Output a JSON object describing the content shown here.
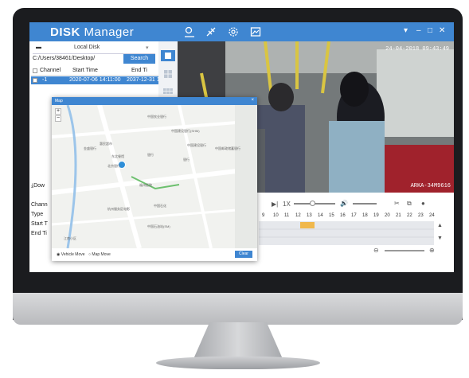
{
  "app": {
    "title_bold": "DISK",
    "title_rest": " Manager",
    "toolbar_icons": [
      "map-pin-icon",
      "satellite-icon",
      "settings-gear-icon",
      "image-export-icon"
    ],
    "window_controls": [
      "wifi-icon",
      "minimize-icon",
      "maximize-icon",
      "close-icon"
    ]
  },
  "left_panel": {
    "disk_label": "Local Disk",
    "path": "C:/Users/38461/Desktop/",
    "search_label": "Search",
    "table": {
      "headers": [
        "Channel",
        "Start Time",
        "End Ti"
      ],
      "rows": [
        {
          "channel": "-1",
          "start": "2020-07-06 14:11:00",
          "end": "2037-12-31 1"
        }
      ]
    },
    "download_label": "Dow",
    "info_labels": [
      "Chann",
      "Type",
      "Start T",
      "End Ti"
    ]
  },
  "video": {
    "timestamp": "24-04-2018 09:43:49",
    "plate": "ARKA-34M9616"
  },
  "playback": {
    "speed": "1X",
    "hours": [
      "9",
      "10",
      "11",
      "12",
      "13",
      "14",
      "15",
      "16",
      "17",
      "18",
      "19",
      "20",
      "21",
      "22",
      "23",
      "24"
    ]
  },
  "map": {
    "window_title": "Map",
    "pois": [
      "中国农业银行",
      "中国建设银行(SHM)",
      "中国建设银行",
      "中国邮政储蓄银行",
      "惠民超市",
      "金盛银行",
      "东北餐馆",
      "银行",
      "银行",
      "北京银行",
      "福州医院",
      "中国石化",
      "杭州服务区电影",
      "中国石油站(SM)",
      "江南小区"
    ],
    "option_vehicle": "Vehicle Move",
    "option_map": "Map Move",
    "clear_label": "Clear"
  }
}
